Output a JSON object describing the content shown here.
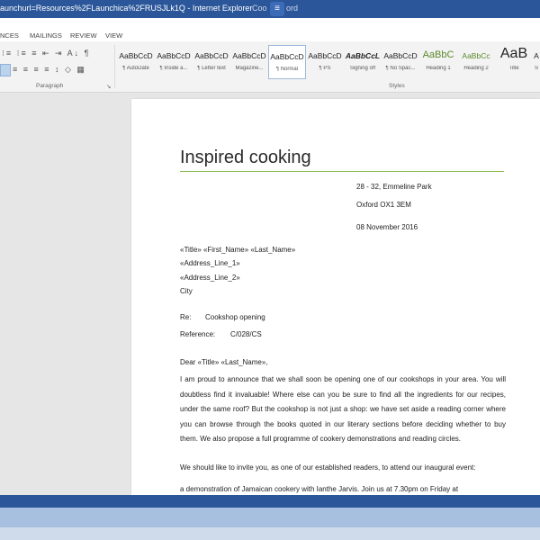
{
  "titlebar": {
    "url_text": "aunchurl=Resources%2FLaunchica%2FRUSJLk1Q - Internet Explorer",
    "doc_text": "Coo",
    "doc_text_right": "ord"
  },
  "ribbon_tabs": [
    "NCES",
    "MAILINGS",
    "REVIEW",
    "VIEW"
  ],
  "paragraph_group": {
    "label": "Paragraph",
    "row1": "⁝≡ ⁝≡ ≡ ⇤ ⇥ A↓ ¶",
    "row2": "≡ ≡ ≡ ≡ ↕ ◇ ▦"
  },
  "styles_group": {
    "label": "Styles",
    "items": [
      {
        "sample": "AaBbCcD",
        "name": "¶ AutoDate"
      },
      {
        "sample": "AaBbCcD",
        "name": "¶ Inside a..."
      },
      {
        "sample": "AaBbCcD",
        "name": "¶ Letter text"
      },
      {
        "sample": "AaBbCcD",
        "name": "Magazine..."
      },
      {
        "sample": "AaBbCcD",
        "name": "¶ Normal"
      },
      {
        "sample": "AaBbCcD",
        "name": "¶ PS"
      },
      {
        "sample": "AaBbCcL",
        "name": "Signing off"
      },
      {
        "sample": "AaBbCcD",
        "name": "¶ No Spac..."
      },
      {
        "sample": "AaBbC",
        "name": "Heading 1"
      },
      {
        "sample": "AaBbCc",
        "name": "Heading 2"
      },
      {
        "sample": "AaB",
        "name": "Title"
      },
      {
        "sample": "A",
        "name": "S"
      }
    ]
  },
  "document": {
    "title": "Inspired cooking",
    "address_line1": "28 - 32, Emmeline Park",
    "address_line2": "Oxford OX1 3EM",
    "date": "08 November 2016",
    "merge_line1": "«Title» «First_Name» «Last_Name»",
    "merge_line2": "«Address_Line_1»",
    "merge_line3": "«Address_Line_2»",
    "merge_line4": "City",
    "re_label": "Re:",
    "re_value": "Cookshop opening",
    "ref_label": "Reference:",
    "ref_value": "C/028/CS",
    "salutation": "Dear «Title» «Last_Name»,",
    "para1": "I am proud to announce that we shall soon be opening one of our cookshops in your area. You will doubtless find it invaluable! Where else can you be sure to find all the ingredients for our recipes, under the same roof? But the cookshop is not just a shop: we have set aside a reading corner where you can browse through the books quoted in our literary sections before deciding whether to buy them. We also propose a full programme of cookery demonstrations and reading circles.",
    "para2": "We should like to invite you, as one of our established readers, to attend our inaugural event:",
    "para3": "a demonstration of Jamaican cookery with Ianthe Jarvis. Join us at 7.30pm on Friday at"
  }
}
